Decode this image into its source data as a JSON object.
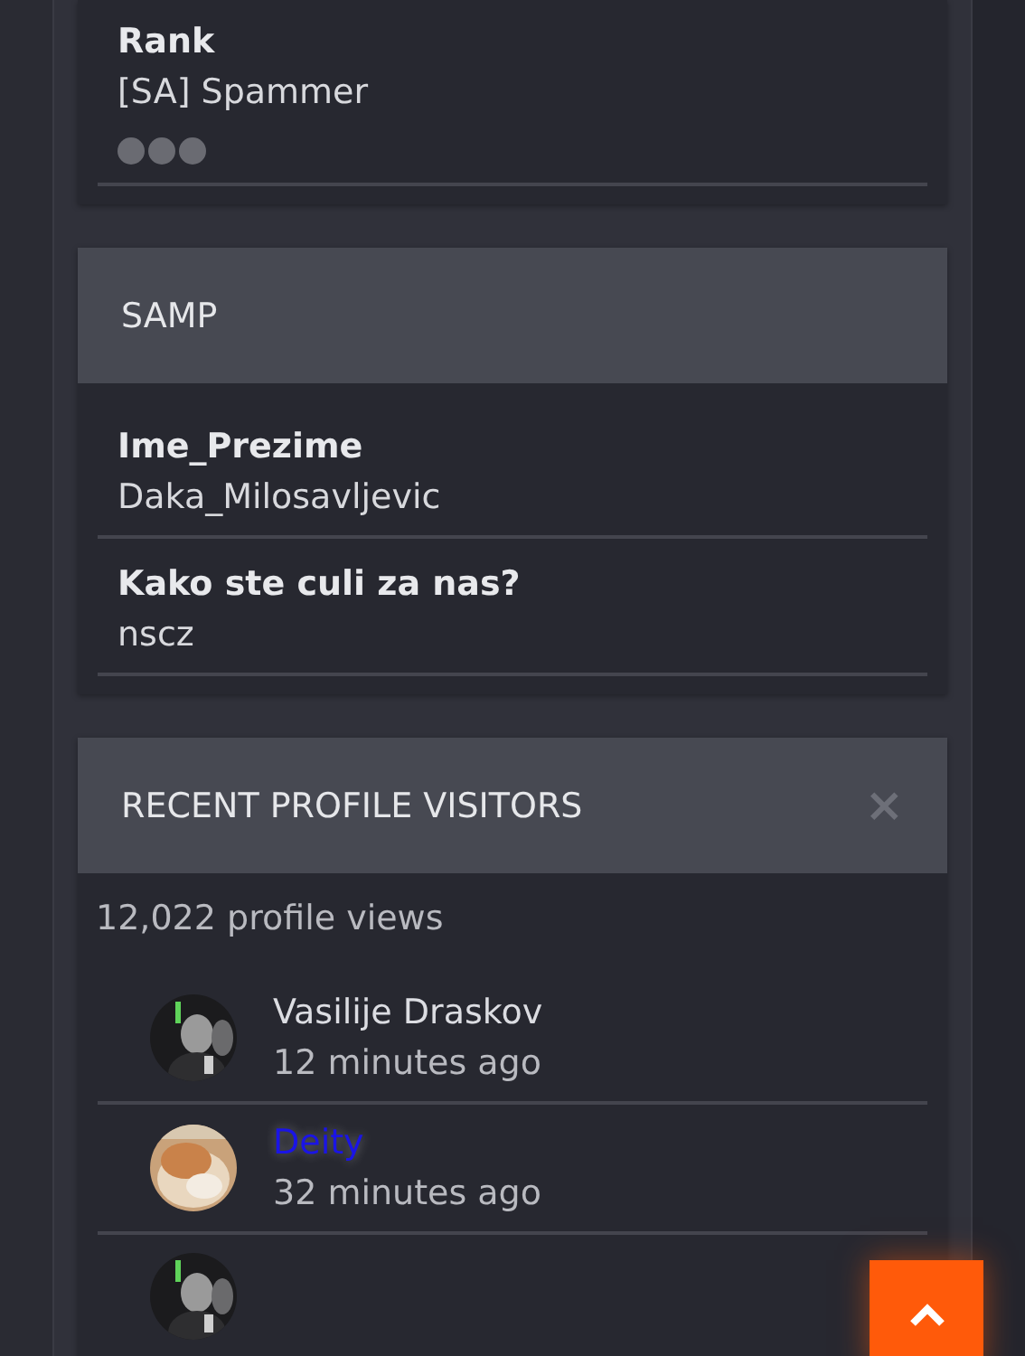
{
  "rank_card": {
    "label": "Rank",
    "value": "[SA] Spammer"
  },
  "samp": {
    "title": "SAMP",
    "fields": [
      {
        "label": "Ime_Prezime",
        "value": "Daka_Milosavljevic"
      },
      {
        "label": "Kako ste culi za nas?",
        "value": "nscz"
      }
    ]
  },
  "visitors": {
    "title": "RECENT PROFILE VISITORS",
    "close": "×",
    "views": "12,022 profile views",
    "items": [
      {
        "name": "Vasilije Draskov",
        "time": "12 minutes ago",
        "color": "#dcdde2",
        "kind": "picture"
      },
      {
        "name": "Deity",
        "time": "32 minutes ago",
        "color": "#1a14e6",
        "kind": "picture"
      },
      {
        "kind": "picture"
      }
    ]
  }
}
